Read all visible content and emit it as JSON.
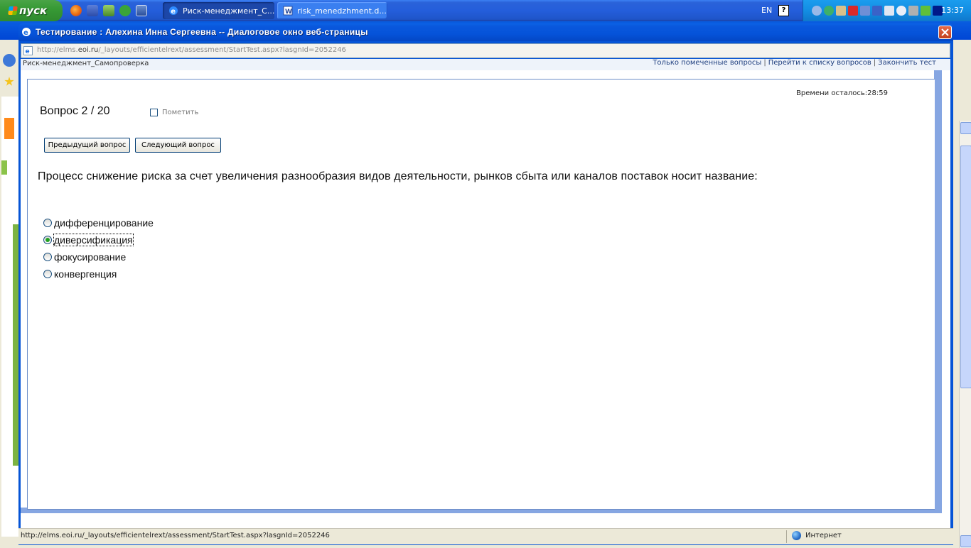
{
  "taskbar": {
    "start_label": "пуск",
    "tasks": [
      {
        "label": "Риск-менеджмент_С...",
        "active": true
      },
      {
        "label": "risk_menedzhment.d...",
        "active": false
      }
    ],
    "tray": {
      "language": "EN",
      "clock": "13:37"
    }
  },
  "dialog": {
    "title": "Тестирование : Алехина Инна Сергеевна -- Диалоговое окно веб-страницы",
    "address": {
      "prefix": "http://elms.",
      "domain": "eoi.ru",
      "path": "/_layouts/efficientelrext/assessment/StartTest.aspx?lasgnId=2052246"
    },
    "course_name": "Риск-менеджмент_Самопроверка",
    "links": {
      "marked_only": "Только помеченные вопросы",
      "question_list": "Перейти к списку вопросов",
      "finish": "Закончить тест",
      "separator": "|"
    },
    "timer": "Времени осталось:28:59",
    "question_number": "Вопрос 2 / 20",
    "mark_label": "Пометить",
    "prev_button": "Предыдущий вопрос",
    "next_button": "Следующий вопрос",
    "question_text": "Процесс снижение риска за счет увеличения разнообразия видов деятельности, рынков сбыта или каналов поставок носит название:",
    "answers": [
      {
        "label": "дифференцирование",
        "selected": false
      },
      {
        "label": "диверсификация",
        "selected": true
      },
      {
        "label": "фокусирование",
        "selected": false
      },
      {
        "label": "конвергенция",
        "selected": false
      }
    ]
  },
  "statusbar": {
    "url": "http://elms.eoi.ru/_layouts/efficientelrext/assessment/StartTest.aspx?lasgnId=2052246",
    "zone": "Интернет"
  },
  "colors": {
    "title_blue": "#0553d9",
    "radio_selected": "#21a121"
  }
}
